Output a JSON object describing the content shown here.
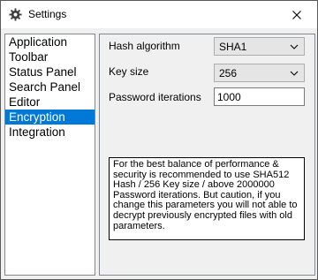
{
  "window": {
    "title": "Settings"
  },
  "nav": {
    "items": [
      {
        "label": "Application"
      },
      {
        "label": "Toolbar"
      },
      {
        "label": "Status Panel"
      },
      {
        "label": "Search Panel"
      },
      {
        "label": "Editor"
      },
      {
        "label": "Encryption"
      },
      {
        "label": "Integration"
      }
    ],
    "selected": "Encryption"
  },
  "encryption": {
    "hash_algorithm_label": "Hash algorithm",
    "hash_algorithm_value": "SHA1",
    "key_size_label": "Key size",
    "key_size_value": "256",
    "password_iterations_label": "Password iterations",
    "password_iterations_value": "1000",
    "note": "For the best balance of performance & security is recommended to use SHA512 Hash / 256 Key size / above 2000000 Password iterations. But caution, if you change this parameters you will not able to decrypt previously encrypted files with old parameters."
  },
  "icons": {
    "window_icon": "gear-icon",
    "close": "close-icon",
    "dropdown": "chevron-down-icon"
  },
  "colors": {
    "selection": "#0078d7",
    "selection_text": "#ffffff"
  }
}
